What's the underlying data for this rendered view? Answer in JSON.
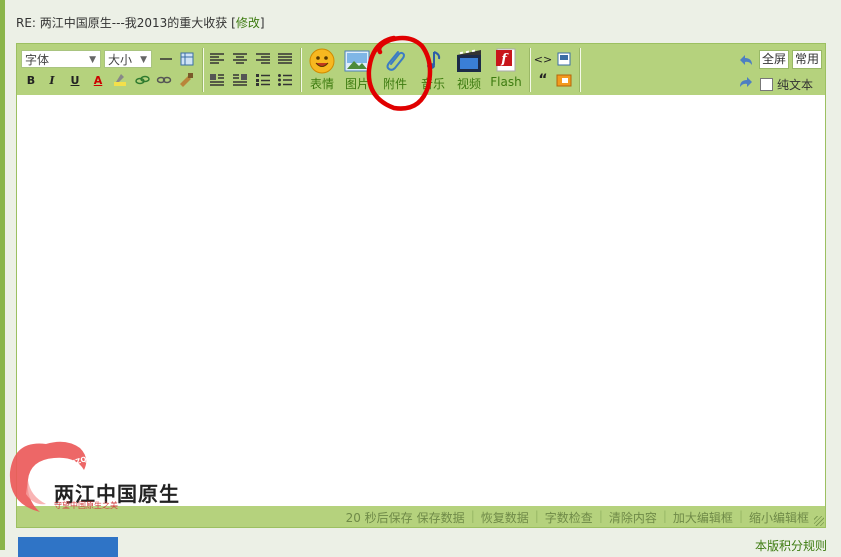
{
  "title": {
    "text": "RE: 两江中国原生---我2013的重大收获 [",
    "edit_link": "修改",
    "close": "]"
  },
  "toolbar": {
    "font_dropdown": "字体",
    "size_dropdown": "大小",
    "buttons": [
      {
        "label": "表情",
        "icon": "smiley-icon"
      },
      {
        "label": "图片",
        "icon": "image-icon"
      },
      {
        "label": "附件",
        "icon": "paperclip-icon"
      },
      {
        "label": "音乐",
        "icon": "music-icon"
      },
      {
        "label": "视频",
        "icon": "video-icon"
      },
      {
        "label": "Flash",
        "icon": "flash-icon"
      }
    ],
    "fullscreen": "全屏",
    "common": "常用",
    "plain_text": "纯文本"
  },
  "status_bar": {
    "autosave": "20 秒后保存",
    "save_data": "保存数据",
    "restore_data": "恢复数据",
    "word_check": "字数检查",
    "clear_content": "清除内容",
    "enlarge": "加大编辑框",
    "shrink": "缩小编辑框"
  },
  "watermark": {
    "main": "两江中国原生",
    "sub": "守望中国原生之美",
    "url": "WWW.COHZQ.COM"
  },
  "bottom_right_link": "本版积分规则",
  "colors": {
    "toolbar": "#b5d27d",
    "accent_green": "#3d7b10",
    "annotation_red": "#e00000"
  }
}
